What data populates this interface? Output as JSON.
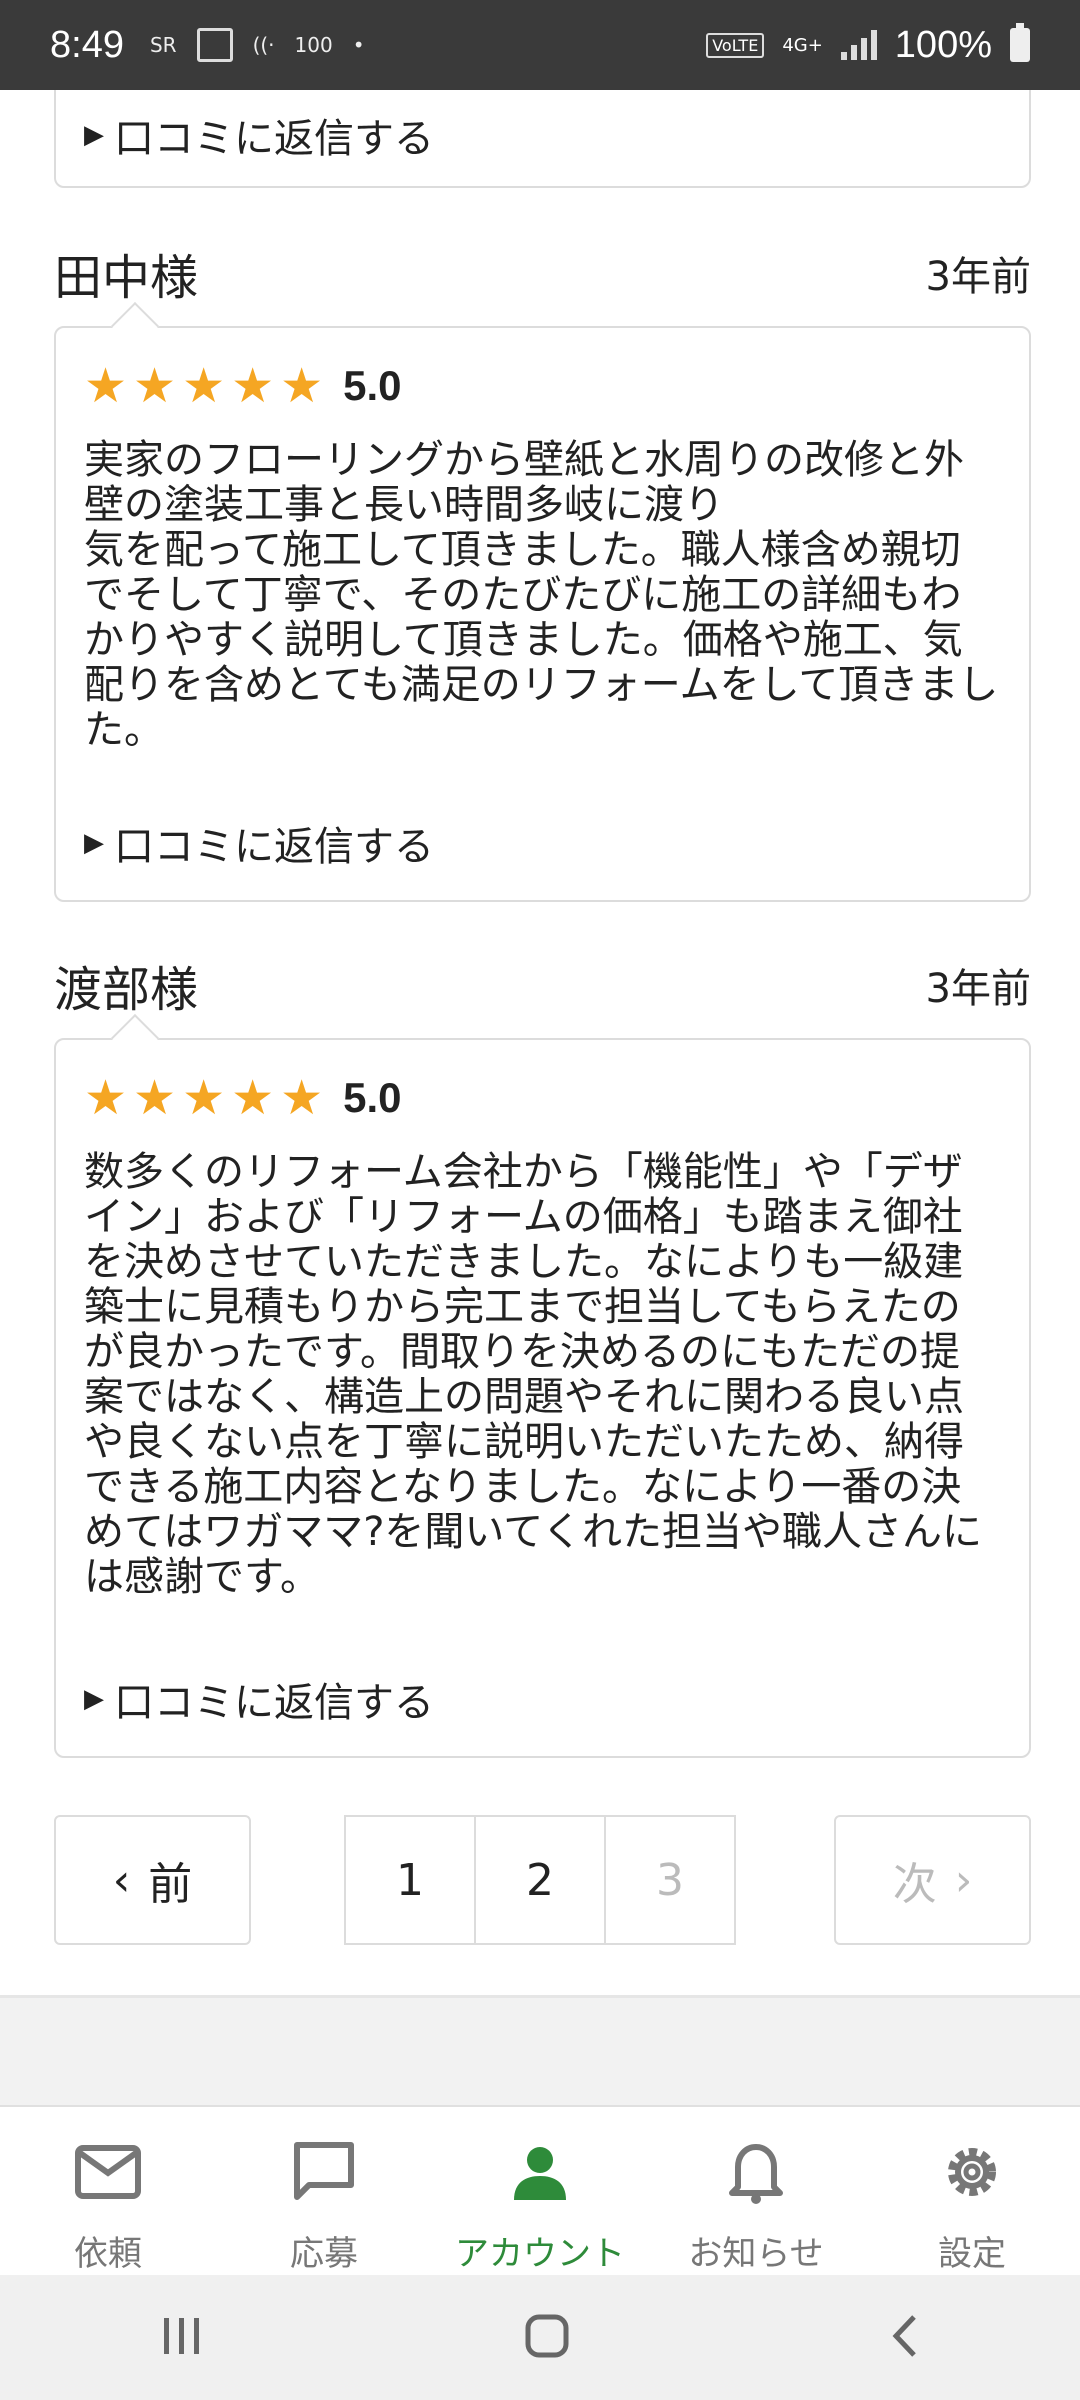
{
  "status_bar": {
    "time": "8:49",
    "left_badges": [
      "SR",
      "100"
    ],
    "network": "4G+",
    "volte": "VoLTE",
    "battery": "100%"
  },
  "reviews": [
    {
      "reply_label": "口コミに返信する"
    },
    {
      "name": "田中様",
      "time": "3年前",
      "rating": 5,
      "score": "5.0",
      "text": "実家のフローリングから壁紙と水周りの改修と外壁の塗装工事と長い時間多岐に渡り\n気を配って施工して頂きました。職人様含め親切でそして丁寧で、そのたびたびに施工の詳細もわかりやすく説明して頂きました。価格や施工、気配りを含めとても満足のリフォームをして頂きました。",
      "reply_label": "口コミに返信する"
    },
    {
      "name": "渡部様",
      "time": "3年前",
      "rating": 5,
      "score": "5.0",
      "text": "数多くのリフォーム会社から「機能性」や「デザイン」および「リフォームの価格」も踏まえ御社を決めさせていただきました。なによりも一級建築士に見積もりから完工まで担当してもらえたのが良かったです。間取りを決めるのにもただの提案ではなく、構造上の問題やそれに関わる良い点や良くない点を丁寧に説明いただいたため、納得できる施工内容となりました。なにより一番の決めてはワガママ?を聞いてくれた担当や職人さんには感謝です。",
      "reply_label": "口コミに返信する"
    }
  ],
  "pagination": {
    "prev_label": "前",
    "next_label": "次",
    "pages": [
      "1",
      "2",
      "3"
    ],
    "current_page": "3"
  },
  "bottom_nav": {
    "items": [
      {
        "label": "依頼",
        "icon": "mail-icon"
      },
      {
        "label": "応募",
        "icon": "chat-icon"
      },
      {
        "label": "アカウント",
        "icon": "person-icon"
      },
      {
        "label": "お知らせ",
        "icon": "bell-icon"
      },
      {
        "label": "設定",
        "icon": "gear-icon"
      }
    ],
    "active": "アカウント"
  },
  "colors": {
    "star": "#f5a623",
    "active_nav": "#2e8b3a",
    "border": "#dcdcdc"
  }
}
